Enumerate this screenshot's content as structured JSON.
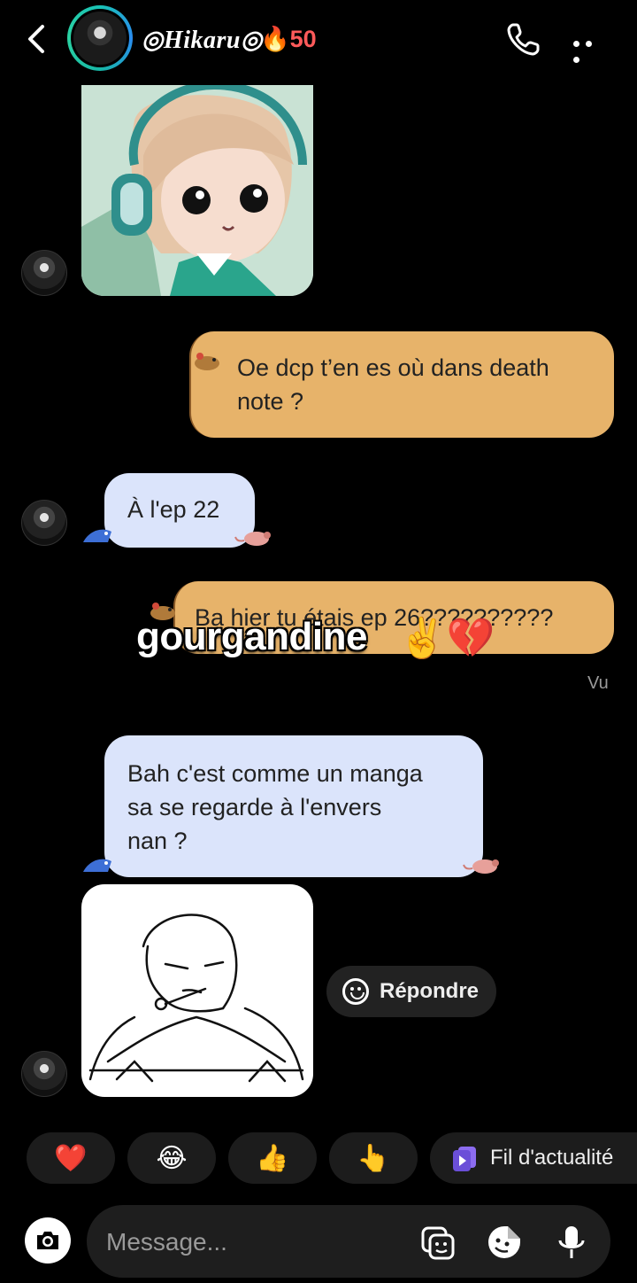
{
  "header": {
    "contact_name": "◎Hikaru◎",
    "streak_icon": "🔥",
    "streak_count": "50"
  },
  "messages": [
    {
      "type": "image",
      "from": "them",
      "description_icon": "anime-avatar-headphones"
    },
    {
      "type": "text",
      "from": "me",
      "lines": [
        "Oe dcp t’en es où dans death",
        "note ?"
      ]
    },
    {
      "type": "text",
      "from": "them",
      "lines": [
        "À l'ep 22"
      ]
    },
    {
      "type": "text",
      "from": "me",
      "lines": [
        "Ba hier tu étais ep 26??????????"
      ]
    },
    {
      "type": "text",
      "from": "them",
      "lines": [
        "Bah c'est comme un manga",
        "sa se regarde à l'envers",
        "nan ?"
      ]
    },
    {
      "type": "image",
      "from": "them",
      "description_icon": "sketch-character"
    }
  ],
  "seen_label": "Vu",
  "overlay": {
    "text": "gourgandine",
    "emoji": "✌️💔"
  },
  "reply_button": {
    "label": "Répondre"
  },
  "reactions": [
    "❤️",
    "😂",
    "👍",
    "👆"
  ],
  "feed_button": {
    "label": "Fil d'actualité"
  },
  "composer": {
    "placeholder": "Message..."
  },
  "colors": {
    "outgoing_bubble": "#e7b36a",
    "incoming_bubble": "#dbe4fb",
    "streak": "#ff5a5a"
  }
}
